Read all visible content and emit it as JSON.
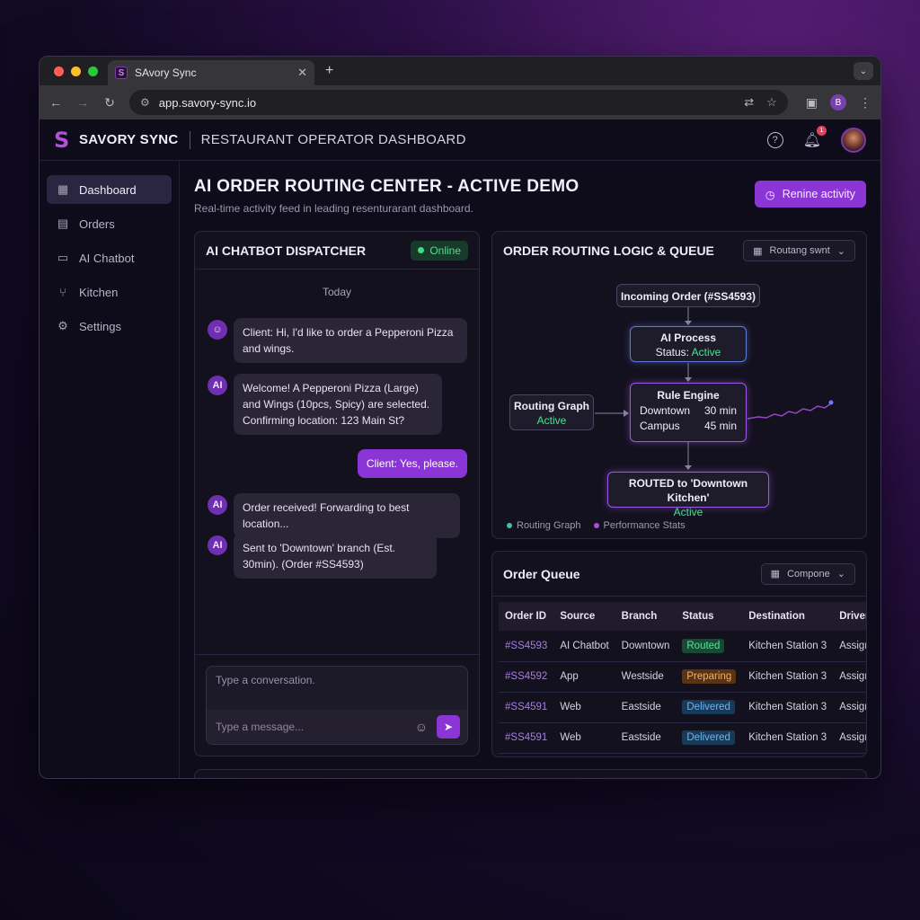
{
  "browser": {
    "tab_title": "SAvory Sync",
    "url": "app.savory-sync.io",
    "profile_initial": "B"
  },
  "header": {
    "brand": "SAVORY SYNC",
    "subtitle": "RESTAURANT OPERATOR DASHBOARD",
    "notification_count": "1"
  },
  "sidebar": {
    "items": [
      {
        "label": "Dashboard",
        "icon": "grid-icon",
        "active": true
      },
      {
        "label": "Orders",
        "icon": "clipboard-icon"
      },
      {
        "label": "AI Chatbot",
        "icon": "chat-icon"
      },
      {
        "label": "Kitchen",
        "icon": "utensils-icon"
      },
      {
        "label": "Settings",
        "icon": "gear-icon"
      }
    ]
  },
  "main": {
    "title": "AI ORDER ROUTING CENTER - ACTIVE DEMO",
    "subtitle": "Real-time activity feed in leading resenturarant dashboard.",
    "action_button": "Renine activity"
  },
  "chat": {
    "title": "AI CHATBOT DISPATCHER",
    "status": "Online",
    "date": "Today",
    "messages": [
      {
        "sender": "client",
        "text": "Client: Hi, I'd like to order a Pepperoni Pizza and wings."
      },
      {
        "sender": "ai",
        "avatar": "AI",
        "text": "Welcome! A Pepperoni Pizza (Large) and Wings (10pcs, Spicy) are selected. Confirming location: 123 Main St?"
      },
      {
        "sender": "user",
        "text": "Client: Yes, please."
      },
      {
        "sender": "ai",
        "avatar": "AI",
        "text": "Order received! Forwarding to best location..."
      },
      {
        "sender": "ai",
        "avatar": "AI",
        "text": "Sent to 'Downtown' branch (Est. 30min). (Order #SS4593)"
      }
    ],
    "composer_placeholder_top": "Type a conversation.",
    "composer_placeholder": "Type a message..."
  },
  "routing": {
    "title": "ORDER ROUTING LOGIC & QUEUE",
    "select_label": "Routang swnt",
    "nodes": {
      "incoming": "Incoming Order (#SS4593)",
      "ai_process": "AI Process",
      "ai_status_label": "Status:",
      "ai_status": "Active",
      "graph_title": "Routing Graph",
      "graph_status": "Active",
      "engine_title": "Rule Engine",
      "engine_rows": [
        {
          "name": "Downtown",
          "time": "30 min"
        },
        {
          "name": "Campus",
          "time": "45 min"
        }
      ],
      "routed_title": "ROUTED to 'Downtown Kitchen'",
      "routed_status": "Active"
    },
    "legend": [
      "Routing Graph",
      "Performance Stats"
    ],
    "colors": {
      "graph": "#3fc3a0",
      "stats": "#a34fd8"
    }
  },
  "queue": {
    "title": "Order Queue",
    "select_label": "Compone",
    "columns": [
      "Order ID",
      "Source",
      "Branch",
      "Status",
      "Destination",
      "Driver"
    ],
    "rows": [
      {
        "id": "#SS4593",
        "source": "AI Chatbot",
        "branch": "Downtown",
        "status": "Routed",
        "kind": "routed",
        "dest": "Kitchen Station 3",
        "driver": "Assigning"
      },
      {
        "id": "#SS4592",
        "source": "App",
        "branch": "Westside",
        "status": "Preparing",
        "kind": "preparing",
        "dest": "Kitchen Station 3",
        "driver": "Assigning"
      },
      {
        "id": "#SS4591",
        "source": "Web",
        "branch": "Eastside",
        "status": "Delivered",
        "kind": "delivered",
        "dest": "Kitchen Station 3",
        "driver": "Assigning"
      },
      {
        "id": "#SS4591",
        "source": "Web",
        "branch": "Eastside",
        "status": "Delivered",
        "kind": "delivered",
        "dest": "Kitchen Station 3",
        "driver": "Assigning"
      }
    ]
  }
}
